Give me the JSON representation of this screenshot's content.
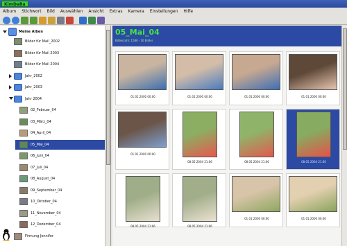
{
  "window": {
    "title": "KimDaBa"
  },
  "menu": [
    "Album",
    "Stichwort",
    "Bild",
    "Auswählen",
    "Ansicht",
    "Extras",
    "Kamera",
    "Einstellungen",
    "Hilfe"
  ],
  "toolbar_icons": [
    "zoom-in-icon",
    "zoom-out-icon",
    "back-icon",
    "forward-icon",
    "home-icon",
    "folder-icon",
    "save-icon",
    "edit-icon",
    "search-icon",
    "slideshow-icon",
    "view-icon"
  ],
  "sidebar": {
    "root": "Meine Alben",
    "items": [
      {
        "label": "Bilder für Mail_2002",
        "level": 1,
        "kind": "thumb",
        "color": "#7c8f6a"
      },
      {
        "label": "Bilder für Mail 2003",
        "level": 1,
        "kind": "thumb",
        "color": "#8a6f5b"
      },
      {
        "label": "Bilder für Mail 2004",
        "level": 1,
        "kind": "thumb",
        "color": "#6f7f8f"
      },
      {
        "label": "Jahr_2002",
        "level": 1,
        "kind": "folder",
        "color": "#4b86d8"
      },
      {
        "label": "Jahr_2003",
        "level": 1,
        "kind": "folder",
        "color": "#4b86d8"
      },
      {
        "label": "Jahr 2004",
        "level": 1,
        "kind": "folder-open",
        "color": "#4b86d8"
      },
      {
        "label": "02_Februar_04",
        "level": 2,
        "kind": "thumb",
        "color": "#8fa07a"
      },
      {
        "label": "03_März_04",
        "level": 2,
        "kind": "thumb",
        "color": "#6a8b5a"
      },
      {
        "label": "04_April_04",
        "level": 2,
        "kind": "thumb",
        "color": "#b99a7a"
      },
      {
        "label": "05_Mai_04",
        "level": 2,
        "kind": "thumb",
        "color": "#5a8a5a",
        "selected": true
      },
      {
        "label": "06_Juni_04",
        "level": 2,
        "kind": "thumb",
        "color": "#7a9a6a"
      },
      {
        "label": "07_Juli_04",
        "level": 2,
        "kind": "thumb",
        "color": "#9a8a6a"
      },
      {
        "label": "08_August_04",
        "level": 2,
        "kind": "thumb",
        "color": "#6a9a7a"
      },
      {
        "label": "09_September_04",
        "level": 2,
        "kind": "thumb",
        "color": "#8a7a6a"
      },
      {
        "label": "10_Oktober_04",
        "level": 2,
        "kind": "thumb",
        "color": "#7a7a8a"
      },
      {
        "label": "11_November_04",
        "level": 2,
        "kind": "thumb",
        "color": "#9a9a8a"
      },
      {
        "label": "12_Dezember_04",
        "level": 2,
        "kind": "thumb",
        "color": "#8a6a5a"
      },
      {
        "label": "Firmung Jennifer",
        "level": 1,
        "kind": "thumb",
        "color": "#a08a7a"
      }
    ]
  },
  "album": {
    "title": "05_Mai_04",
    "info": "Bilderzahl: 1586 · 16 Bilder"
  },
  "photos": [
    {
      "caption": "01.01.2000 00:00",
      "colors": [
        "#c9b4a0",
        "#3d6fb0"
      ],
      "selected": false
    },
    {
      "caption": "01.01.2000 00:00",
      "colors": [
        "#d4bda8",
        "#4a7cc0"
      ],
      "selected": false
    },
    {
      "caption": "01.01.2000 00:00",
      "colors": [
        "#c7a890",
        "#3f6fb5"
      ],
      "selected": false
    },
    {
      "caption": "01.01.2000 00:00",
      "colors": [
        "#5e4838",
        "#e7c6b0"
      ],
      "selected": false
    },
    {
      "caption": "01.01.2000 00:00",
      "colors": [
        "#6b5548",
        "#7d9fd0"
      ],
      "selected": false
    },
    {
      "caption": "08.05.2004 21:06",
      "colors": [
        "#8cae62",
        "#e7584e"
      ],
      "selected": false
    },
    {
      "caption": "08.05.2004 21:06",
      "colors": [
        "#90b36a",
        "#e25a4d"
      ],
      "selected": false
    },
    {
      "caption": "08.05.2004 21:06",
      "colors": [
        "#87ab60",
        "#e65249"
      ],
      "selected": true
    },
    {
      "caption": "08.05.2004 21:06",
      "colors": [
        "#9fae88",
        "#e8dfd0"
      ],
      "selected": false
    },
    {
      "caption": "08.05.2004 21:06",
      "colors": [
        "#a2ae8a",
        "#ebe2d2"
      ],
      "selected": false
    },
    {
      "caption": "01.01.2000 00:00",
      "colors": [
        "#d8c4a8",
        "#8ea860"
      ],
      "selected": false
    },
    {
      "caption": "01.01.2000 00:00",
      "colors": [
        "#e3d0b0",
        "#8aa45c"
      ],
      "selected": false
    }
  ]
}
